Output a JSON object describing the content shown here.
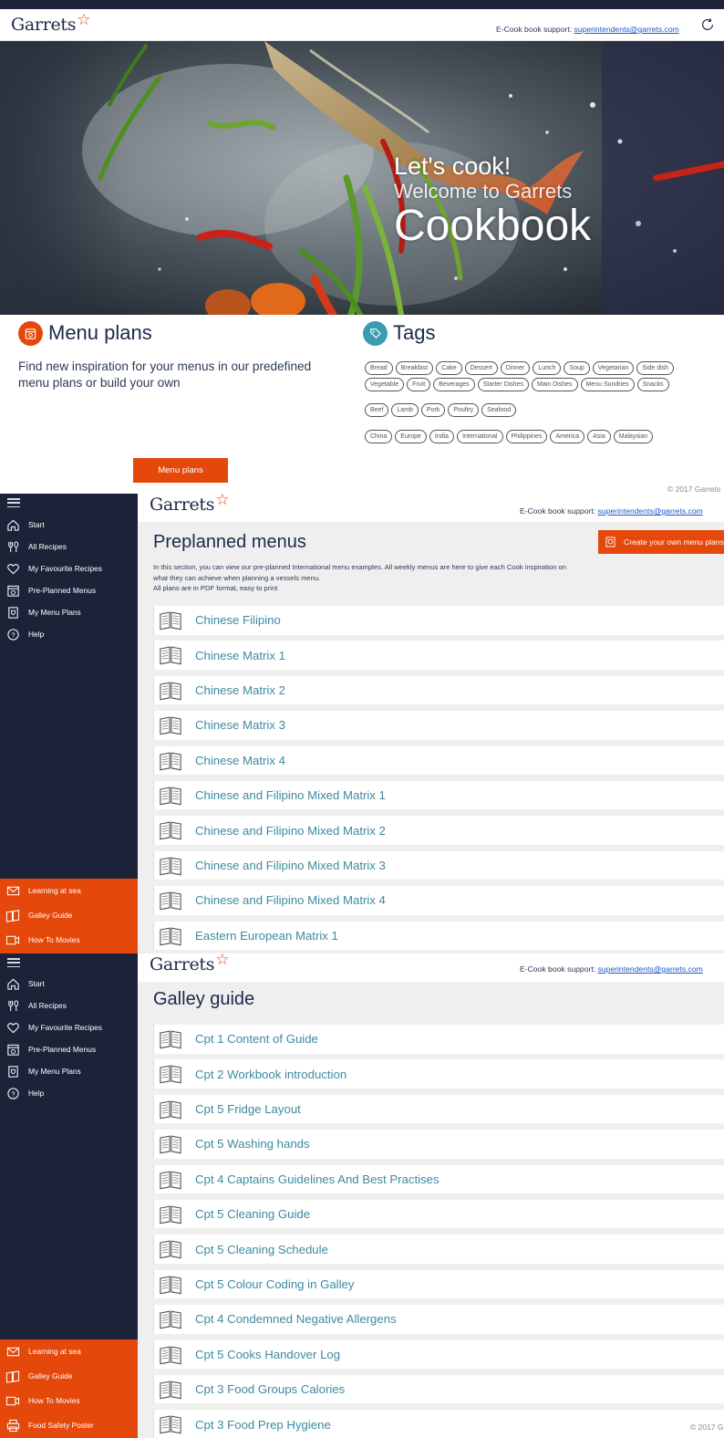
{
  "brand": {
    "name": "Garrets",
    "star": "☆",
    "accent": "#e5480b",
    "navy": "#1c2339",
    "teal": "#3d8aa0"
  },
  "support": {
    "label": "E-Cook book support:",
    "email": "superintendents@garrets.com"
  },
  "hero": {
    "line1": "Let's cook!",
    "line2": "Welcome to Garrets",
    "line3": "Cookbook"
  },
  "menu_plans": {
    "title": "Menu plans",
    "description": "Find new inspiration for your menus in our predefined menu plans or build your own",
    "button": "Menu plans"
  },
  "tags": {
    "title": "Tags",
    "row1": [
      "Bread",
      "Breakfast",
      "Cake",
      "Dessert",
      "Dinner",
      "Lunch",
      "Soup",
      "Vegetarian",
      "Side dish"
    ],
    "row2": [
      "Vegetable",
      "Fruit",
      "Beverages",
      "Starter Dishes",
      "Main Dishes",
      "Menu Sundries",
      "Snacks"
    ],
    "row3": [
      "Beef",
      "Lamb",
      "Pork",
      "Poultry",
      "Seafood"
    ],
    "row4": [
      "China",
      "Europe",
      "India",
      "International",
      "Philippines",
      "America",
      "Asia",
      "Malaysian"
    ]
  },
  "copyright": "© 2017 Garrets",
  "copyright_short": "© 2017 G",
  "nav": {
    "items": [
      "Start",
      "All Recipes",
      "My Favourite Recipes",
      "Pre-Planned Menus",
      "My Menu Plans",
      "Help"
    ],
    "bottom": [
      "Learning at sea",
      "Galley Guide",
      "How To Movies"
    ],
    "bottom_extra": "Food Safety Poster"
  },
  "preplanned": {
    "title": "Preplanned menus",
    "create_button": "Create your own menu plans",
    "intro_l1": "In this section, you can view our pre-planned International menu examples. All weekly menus are here to give each Cook inspiration on",
    "intro_l2": "what they can achieve when planning a vessels menu.",
    "intro_l3": "All plans are in PDF format, easy to print",
    "items": [
      "Chinese Filipino",
      "Chinese Matrix 1",
      "Chinese Matrix 2",
      "Chinese Matrix 3",
      "Chinese Matrix 4",
      "Chinese and Filipino Mixed Matrix 1",
      "Chinese and Filipino Mixed Matrix 2",
      "Chinese and Filipino Mixed Matrix 3",
      "Chinese and Filipino Mixed Matrix 4",
      "Eastern European Matrix 1"
    ]
  },
  "galley": {
    "title": "Galley guide",
    "items": [
      "Cpt 1 Content of Guide",
      "Cpt 2 Workbook introduction",
      "Cpt 5 Fridge Layout",
      "Cpt 5 Washing hands",
      "Cpt 4 Captains Guidelines And Best Practises",
      "Cpt 5 Cleaning Guide",
      "Cpt 5 Cleaning Schedule",
      "Cpt 5 Colour Coding in Galley",
      "Cpt 4 Condemned Negative Allergens",
      "Cpt 5 Cooks Handover Log",
      "Cpt 3 Food Groups Calories",
      "Cpt 3 Food Prep Hygiene"
    ]
  }
}
